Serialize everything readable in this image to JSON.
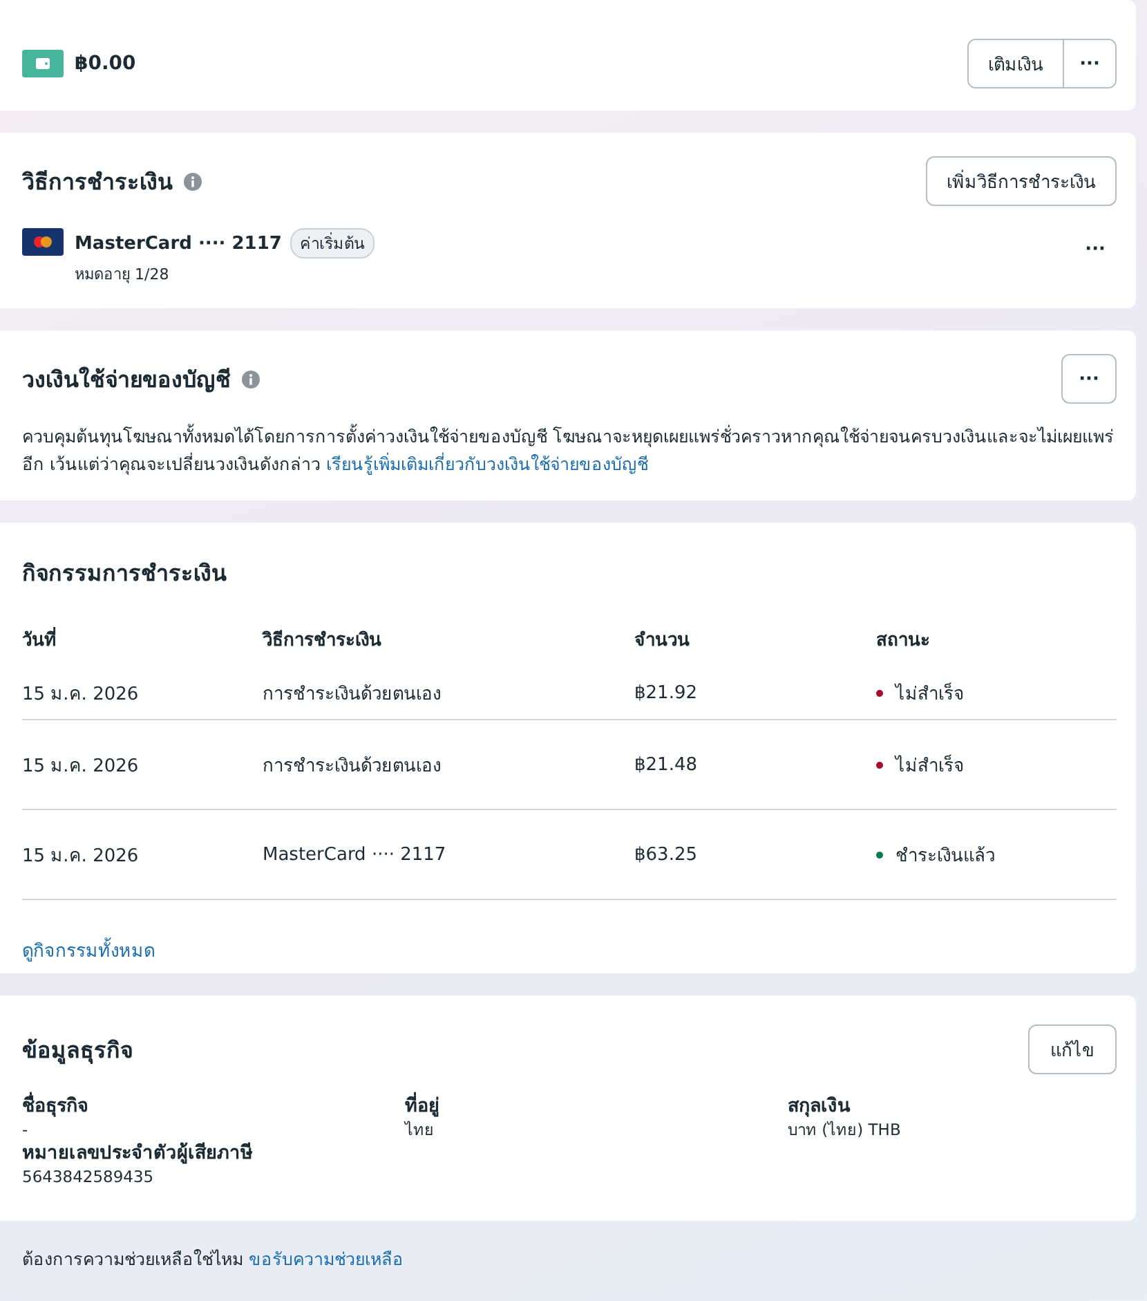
{
  "balance": {
    "amount": "฿0.00",
    "add_funds_button": "เติมเงิน",
    "more_button": "···"
  },
  "payment_methods": {
    "title": "วิธีการชำระเงิน",
    "add_button": "เพิ่มวิธีการชำระเงิน",
    "cards": [
      {
        "name": "MasterCard ···· 2117",
        "badge": "ค่าเริ่มต้น",
        "expiry": "หมดอายุ 1/28",
        "more_button": "···"
      }
    ]
  },
  "spending_limit": {
    "title": "วงเงินใช้จ่ายของบัญชี",
    "more_button": "···",
    "description": "ควบคุมต้นทุนโฆษณาทั้งหมดได้โดยการการตั้งค่าวงเงินใช้จ่ายของบัญชี โฆษณาจะหยุดเผยแพร่ชั่วคราวหากคุณใช้จ่ายจนครบวงเงินและจะไม่เผยแพร่อีก เว้นแต่ว่าคุณจะเปลี่ยนวงเงินดังกล่าว",
    "link": "เรียนรู้เพิ่มเติมเกี่ยวกับวงเงินใช้จ่ายของบัญชี"
  },
  "payment_activity": {
    "title": "กิจกรรมการชำระเงิน",
    "columns": [
      "วันที่",
      "วิธีการชำระเงิน",
      "จำนวน",
      "สถานะ"
    ],
    "rows": [
      {
        "date": "15 ม.ค. 2026",
        "method": "การชำระเงินด้วยตนเอง",
        "amount": "฿21.92",
        "status": "ไม่สำเร็จ",
        "color": "#a50e2d"
      },
      {
        "date": "15 ม.ค. 2026",
        "method": "การชำระเงินด้วยตนเอง",
        "amount": "฿21.48",
        "status": "ไม่สำเร็จ",
        "color": "#a50e2d"
      },
      {
        "date": "15 ม.ค. 2026",
        "method": "MasterCard ···· 2117",
        "amount": "฿63.25",
        "status": "ชำระเงินแล้ว",
        "color": "#0b7a50"
      }
    ],
    "view_all_link": "ดูกิจกรรมทั้งหมด"
  },
  "business_info": {
    "title": "ข้อมูลธุรกิจ",
    "edit_button": "แก้ไข",
    "fields": [
      {
        "label": "ชื่อธุรกิจ",
        "value": "-"
      },
      {
        "label": "หมายเลขประจำตัวผู้เสียภาษี",
        "value": "5643842589435"
      },
      {
        "label": "ที่อยู่",
        "value": "ไทย"
      },
      {
        "label": "สกุลเงิน",
        "value": "บาท (ไทย) THB"
      }
    ]
  },
  "help": {
    "text": "ต้องการความช่วยเหลือใช่ไหม",
    "link": "ขอรับความช่วยเหลือ"
  }
}
